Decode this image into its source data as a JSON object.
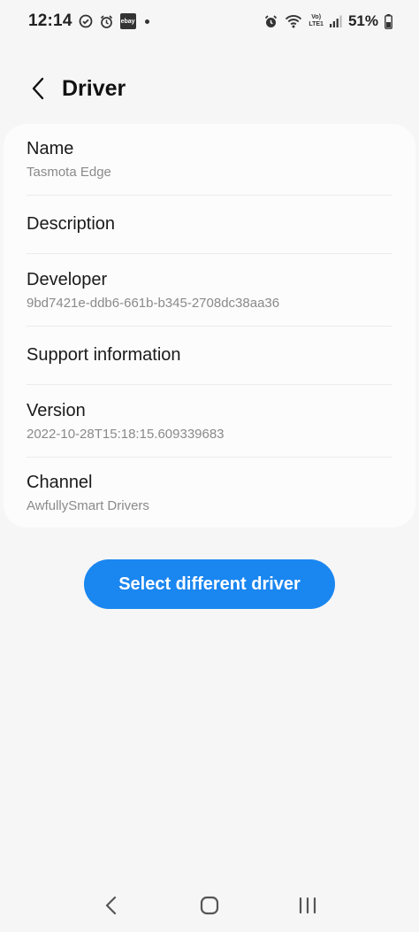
{
  "status_bar": {
    "time": "12:14",
    "ebay_label": "ebay",
    "lte_top": "Vo)",
    "lte_bottom": "LTE1",
    "battery": "51%"
  },
  "header": {
    "title": "Driver"
  },
  "details": {
    "rows": [
      {
        "label": "Name",
        "value": "Tasmota Edge"
      },
      {
        "label": "Description",
        "value": ""
      },
      {
        "label": "Developer",
        "value": "9bd7421e-ddb6-661b-b345-2708dc38aa36"
      },
      {
        "label": "Support information",
        "value": ""
      },
      {
        "label": "Version",
        "value": "2022-10-28T15:18:15.609339683"
      },
      {
        "label": "Channel",
        "value": "AwfullySmart Drivers"
      }
    ]
  },
  "actions": {
    "select_label": "Select different driver"
  },
  "colors": {
    "accent": "#1a86f0",
    "background": "#f6f6f6",
    "card": "#fcfcfc"
  }
}
